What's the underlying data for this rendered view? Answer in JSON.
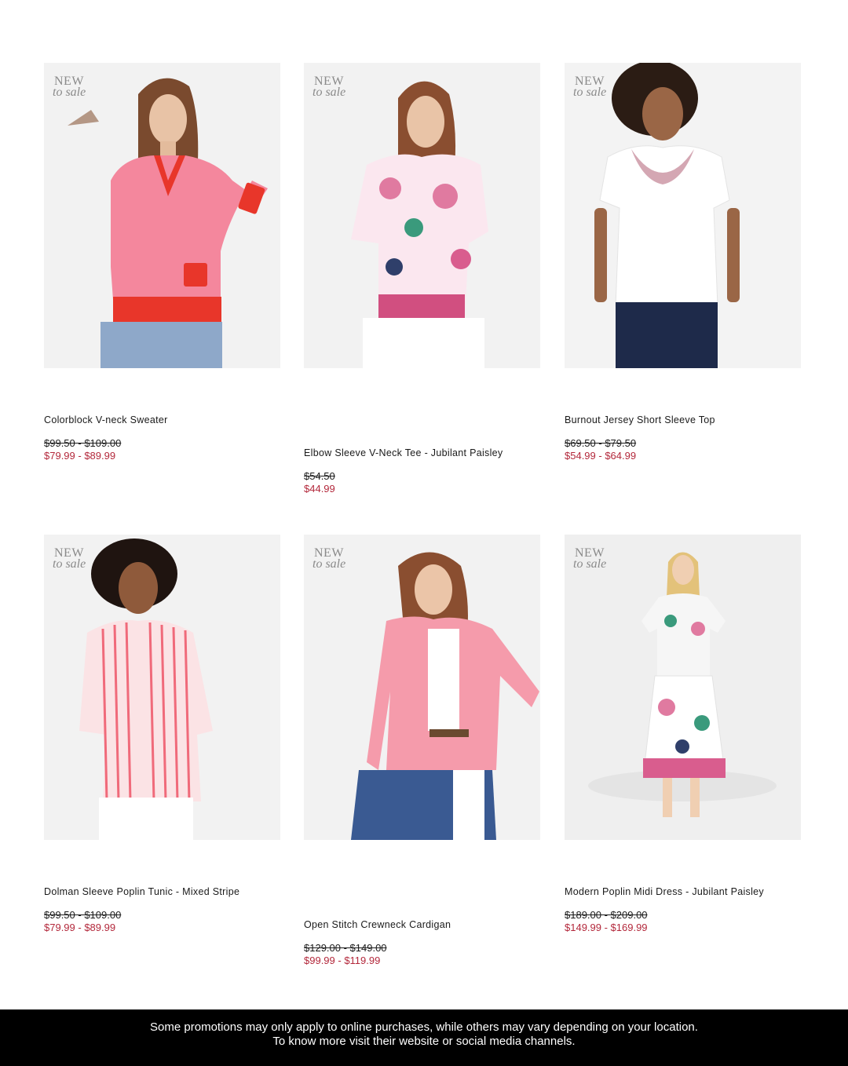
{
  "badge": {
    "line1": "NEW",
    "line2": "to sale"
  },
  "products": [
    {
      "name": "Colorblock V-neck Sweater",
      "was_price": "$99.50 - $109.00",
      "sale_price": "$79.99 - $89.99"
    },
    {
      "name": "Elbow Sleeve V-Neck Tee - Jubilant Paisley",
      "was_price": "$54.50",
      "sale_price": "$44.99"
    },
    {
      "name": "Burnout Jersey Short Sleeve Top",
      "was_price": "$69.50 - $79.50",
      "sale_price": "$54.99 - $64.99"
    },
    {
      "name": "Dolman Sleeve Poplin Tunic - Mixed Stripe",
      "was_price": "$99.50 - $109.00",
      "sale_price": "$79.99 - $89.99"
    },
    {
      "name": "Open Stitch Crewneck Cardigan",
      "was_price": "$129.00 - $149.00",
      "sale_price": "$99.99 - $119.99"
    },
    {
      "name": "Modern Poplin Midi Dress - Jubilant Paisley",
      "was_price": "$189.00 - $209.00",
      "sale_price": "$149.99 - $169.99"
    }
  ],
  "footer": {
    "line1": "Some promotions may only apply to online purchases, while others may vary depending on your location.",
    "line2": "To know more visit their website or social media channels."
  },
  "colors": {
    "sale_price": "#b3283b",
    "footer_bg": "#000000",
    "card_bg": "#f1f1f1"
  }
}
